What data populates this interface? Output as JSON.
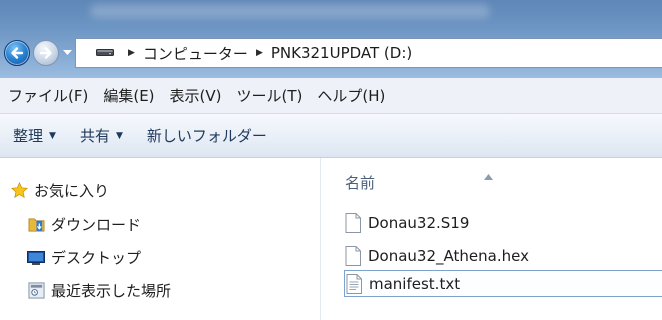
{
  "address": {
    "breadcrumbs": [
      "コンピューター",
      "PNK321UPDAT (D:)"
    ]
  },
  "menu": [
    "ファイル(F)",
    "編集(E)",
    "表示(V)",
    "ツール(T)",
    "ヘルプ(H)"
  ],
  "toolbar": {
    "organize": "整理",
    "share": "共有",
    "new_folder": "新しいフォルダー"
  },
  "nav": {
    "favorites": "お気に入り",
    "items": [
      "ダウンロード",
      "デスクトップ",
      "最近表示した場所"
    ]
  },
  "file_list": {
    "column_name": "名前",
    "files": [
      "Donau32.S19",
      "Donau32_Athena.hex",
      "manifest.txt"
    ],
    "focused_index": 2
  },
  "colors": {
    "title_gradient_top": "#5f87b7",
    "menu_bg": "#eef2f8",
    "toolbar_text": "#1e395b",
    "focus_border": "#7da2ce"
  },
  "icons": {
    "back": "back-arrow-icon",
    "forward": "forward-arrow-icon",
    "drive": "drive-icon",
    "favorites": "star-icon",
    "downloads": "downloads-folder-icon",
    "desktop": "desktop-icon",
    "recent": "recent-places-icon",
    "file": "document-icon",
    "text_file": "text-file-icon"
  }
}
